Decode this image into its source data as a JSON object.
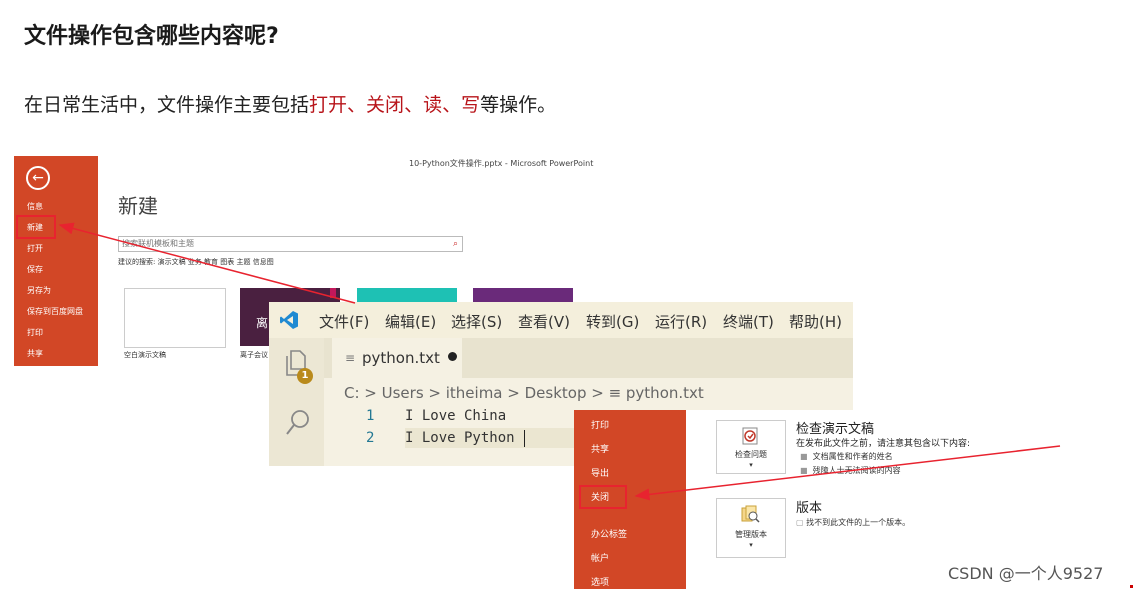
{
  "heading": "文件操作包含哪些内容呢?",
  "intro": {
    "prefix": "在日常生活中，文件操作主要包括",
    "op_open": "打开",
    "sep1": "、",
    "op_close": "关闭",
    "sep2": "、",
    "op_read": "读",
    "sep3": "、",
    "op_write": "写",
    "suffix": "等操作。"
  },
  "ppt_new": {
    "window_title": "10-Python文件操作.pptx - Microsoft PowerPoint",
    "sidebar_items": [
      "信息",
      "新建",
      "打开",
      "保存",
      "另存为",
      "保存到百度网盘",
      "打印",
      "共享"
    ],
    "heading": "新建",
    "search_placeholder": "搜索联机模板和主题",
    "suggest": "建议的搜索:  演示文稿    业务    教育    图表    主题    信息图",
    "template_blank_label": "空白演示文稿",
    "template_dark_label": "离子会议",
    "template_dark_text": "离"
  },
  "vscode": {
    "menu": [
      "文件(F)",
      "编辑(E)",
      "选择(S)",
      "查看(V)",
      "转到(G)",
      "运行(R)",
      "终端(T)",
      "帮助(H)"
    ],
    "badge": "1",
    "tab_label": "python.txt",
    "breadcrumb": "C: > Users > itheima > Desktop > ≡ python.txt",
    "lines": [
      {
        "no": "1",
        "code": "I Love China"
      },
      {
        "no": "2",
        "code": "I Love Python"
      }
    ]
  },
  "ppt_info": {
    "sidebar_items": [
      "打印",
      "共享",
      "导出",
      "关闭",
      "办公标签",
      "帐户",
      "选项"
    ],
    "check_tile_label": "检查问题",
    "check_title": "检查演示文稿",
    "check_desc": "在发布此文件之前，请注意其包含以下内容:",
    "check_bullets": [
      "文档属性和作者的姓名",
      "残障人士无法阅读的内容"
    ],
    "version_tile_label": "管理版本",
    "version_title": "版本",
    "version_desc": "找不到此文件的上一个版本。"
  },
  "watermark": "CSDN @一个人9527",
  "colors": {
    "accent_red": "#b8141a",
    "office_orange": "#d24726",
    "annotation_red": "#e8232f",
    "vscode_bg": "#f5f1e3"
  }
}
